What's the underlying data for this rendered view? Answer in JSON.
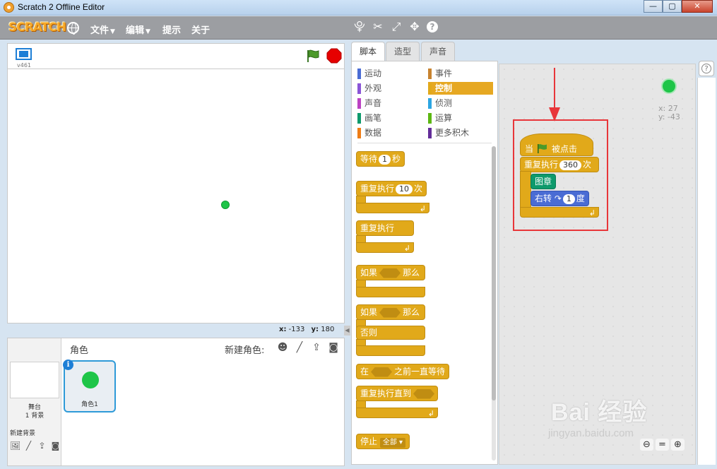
{
  "window": {
    "title": "Scratch 2 Offline Editor",
    "min": "—",
    "max": "▢",
    "close": "✕"
  },
  "menubar": {
    "logo": "SCRATCH",
    "items": [
      {
        "label": "文件",
        "has_caret": true
      },
      {
        "label": "编辑",
        "has_caret": true
      },
      {
        "label": "提示",
        "has_caret": false
      },
      {
        "label": "关于",
        "has_caret": false
      }
    ],
    "caret": "▼"
  },
  "stage": {
    "version": "v461",
    "coords": {
      "x_label": "x:",
      "x": "-133",
      "y_label": "y:",
      "y": "180"
    }
  },
  "tabs": [
    {
      "label": "脚本",
      "active": true
    },
    {
      "label": "造型",
      "active": false
    },
    {
      "label": "声音",
      "active": false
    }
  ],
  "categories": [
    {
      "label": "运动",
      "color": "#4a6cd4"
    },
    {
      "label": "事件",
      "color": "#c88330"
    },
    {
      "label": "外观",
      "color": "#8a55d7"
    },
    {
      "label": "控制",
      "color": "#e1a91a"
    },
    {
      "label": "声音",
      "color": "#bb42c3"
    },
    {
      "label": "侦测",
      "color": "#2ca5e2"
    },
    {
      "label": "画笔",
      "color": "#0e9a6c"
    },
    {
      "label": "运算",
      "color": "#5cb712"
    },
    {
      "label": "数据",
      "color": "#ee7d16"
    },
    {
      "label": "更多积木",
      "color": "#632d99"
    }
  ],
  "palette": {
    "wait": {
      "pre": "等待",
      "value": "1",
      "post": "秒"
    },
    "repeat": {
      "pre": "重复执行",
      "value": "10",
      "post": "次"
    },
    "forever": "重复执行",
    "if_then": {
      "pre": "如果",
      "post": "那么"
    },
    "if_else": {
      "pre": "如果",
      "post": "那么",
      "else": "否则"
    },
    "wait_until": {
      "pre": "在",
      "post": "之前一直等待"
    },
    "repeat_until": "重复执行直到",
    "stop": {
      "pre": "停止",
      "option": "全部",
      "arrow": "▾"
    },
    "loop_arrow": "↲"
  },
  "sprites": {
    "header": "角色",
    "new_sprite": "新建角色:",
    "stage_name": "舞台",
    "stage_backdrops": "1 背景",
    "new_backdrop": "新建背景",
    "sprite_name": "角色1",
    "info_badge": "i",
    "icons": [
      "sprite-library-icon",
      "paint-icon",
      "upload-icon",
      "camera-icon"
    ]
  },
  "script": {
    "hat": {
      "pre": "当",
      "post": "被点击"
    },
    "repeat": {
      "pre": "重复执行",
      "value": "360",
      "post": "次"
    },
    "stamp": "图章",
    "turn": {
      "pre": "右转",
      "icon": "↷",
      "value": "1",
      "post": "度"
    },
    "loop_arrow": "↲"
  },
  "sprite_info": {
    "x": "x: 27",
    "y": "y: -43"
  },
  "help_glyph": "?",
  "watermark": {
    "brand": "Bai 经验",
    "url": "jingyan.baidu.com"
  },
  "colors": {
    "control": "#e1a91a",
    "pen": "#0e9a6c",
    "motion": "#4a6cd4",
    "annotation": "#e8363a",
    "sprite": "#1ec548"
  }
}
